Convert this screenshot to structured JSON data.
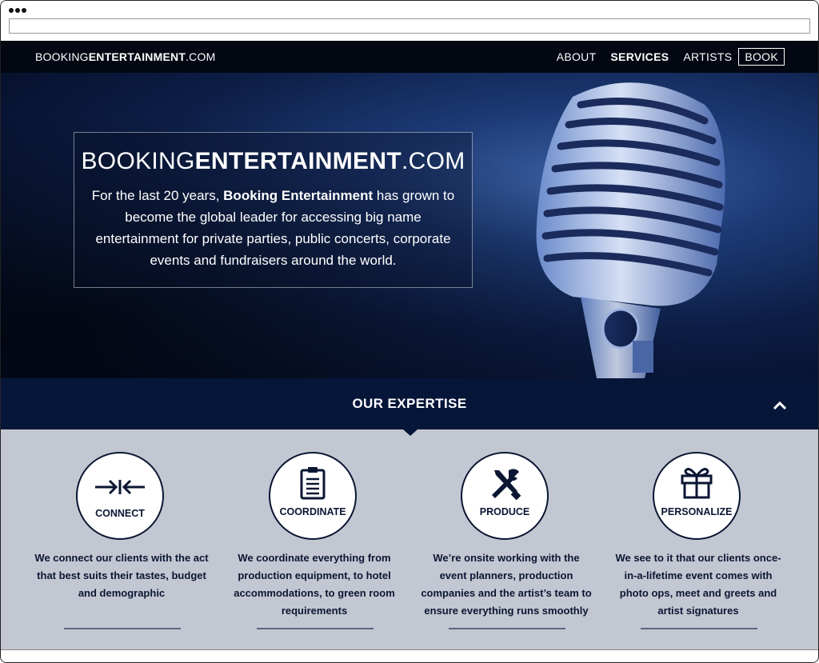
{
  "nav": {
    "logo_pre": "BOOKING",
    "logo_bold": "ENTERTAINMENT",
    "logo_post": ".COM",
    "links": [
      "ABOUT",
      "SERVICES",
      "ARTISTS"
    ],
    "book": "BOOK"
  },
  "hero": {
    "brand_pre": "BOOKING",
    "brand_bold": "ENTERTAINMENT",
    "brand_post": ".COM",
    "text_pre": "For the last 20 years, ",
    "text_bold": "Booking Entertainment",
    "text_post": " has grown to become the global leader for accessing big name entertainment for private parties, public concerts, corporate events and fundraisers around the world."
  },
  "expertise": {
    "title": "OUR EXPERTISE"
  },
  "services": [
    {
      "label": "CONNECT",
      "icon": "connect-arrows-icon",
      "desc": "We connect our clients with the act that best suits their tastes, budget and demographic"
    },
    {
      "label": "COORDINATE",
      "icon": "clipboard-icon",
      "desc": "We  coordinate everything from production equipment, to hotel accommodations, to green room requirements"
    },
    {
      "label": "PRODUCE",
      "icon": "tools-icon",
      "desc": "We’re onsite working with the event planners, production companies and the artist’s team to ensure everything runs smoothly"
    },
    {
      "label": "PERSONALIZE",
      "icon": "gift-icon",
      "desc": "We see to it that our clients once-in-a-lifetime event comes with photo ops, meet and greets and artist signatures"
    }
  ],
  "colors": {
    "nav_bg": "#020712",
    "expertise_bg": "#061639",
    "services_bg": "#c3c7d1",
    "ink": "#0b1633"
  }
}
